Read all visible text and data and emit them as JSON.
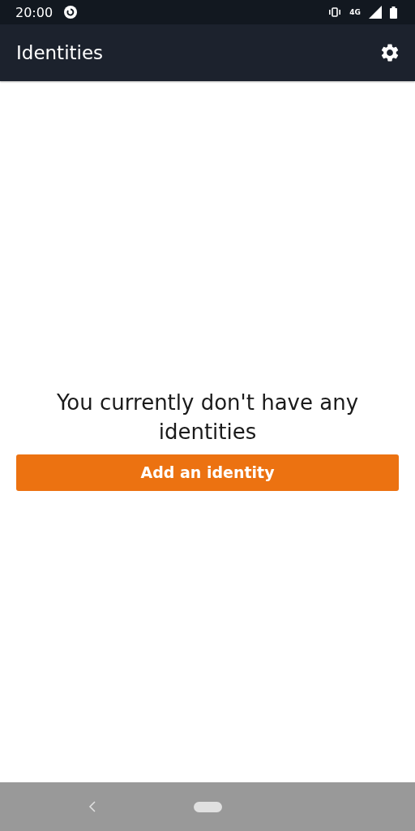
{
  "status_bar": {
    "time": "20:00",
    "network": "4G"
  },
  "app_bar": {
    "title": "Identities"
  },
  "empty_state": {
    "message": "You currently don't have any identities",
    "button": "Add an identity"
  }
}
